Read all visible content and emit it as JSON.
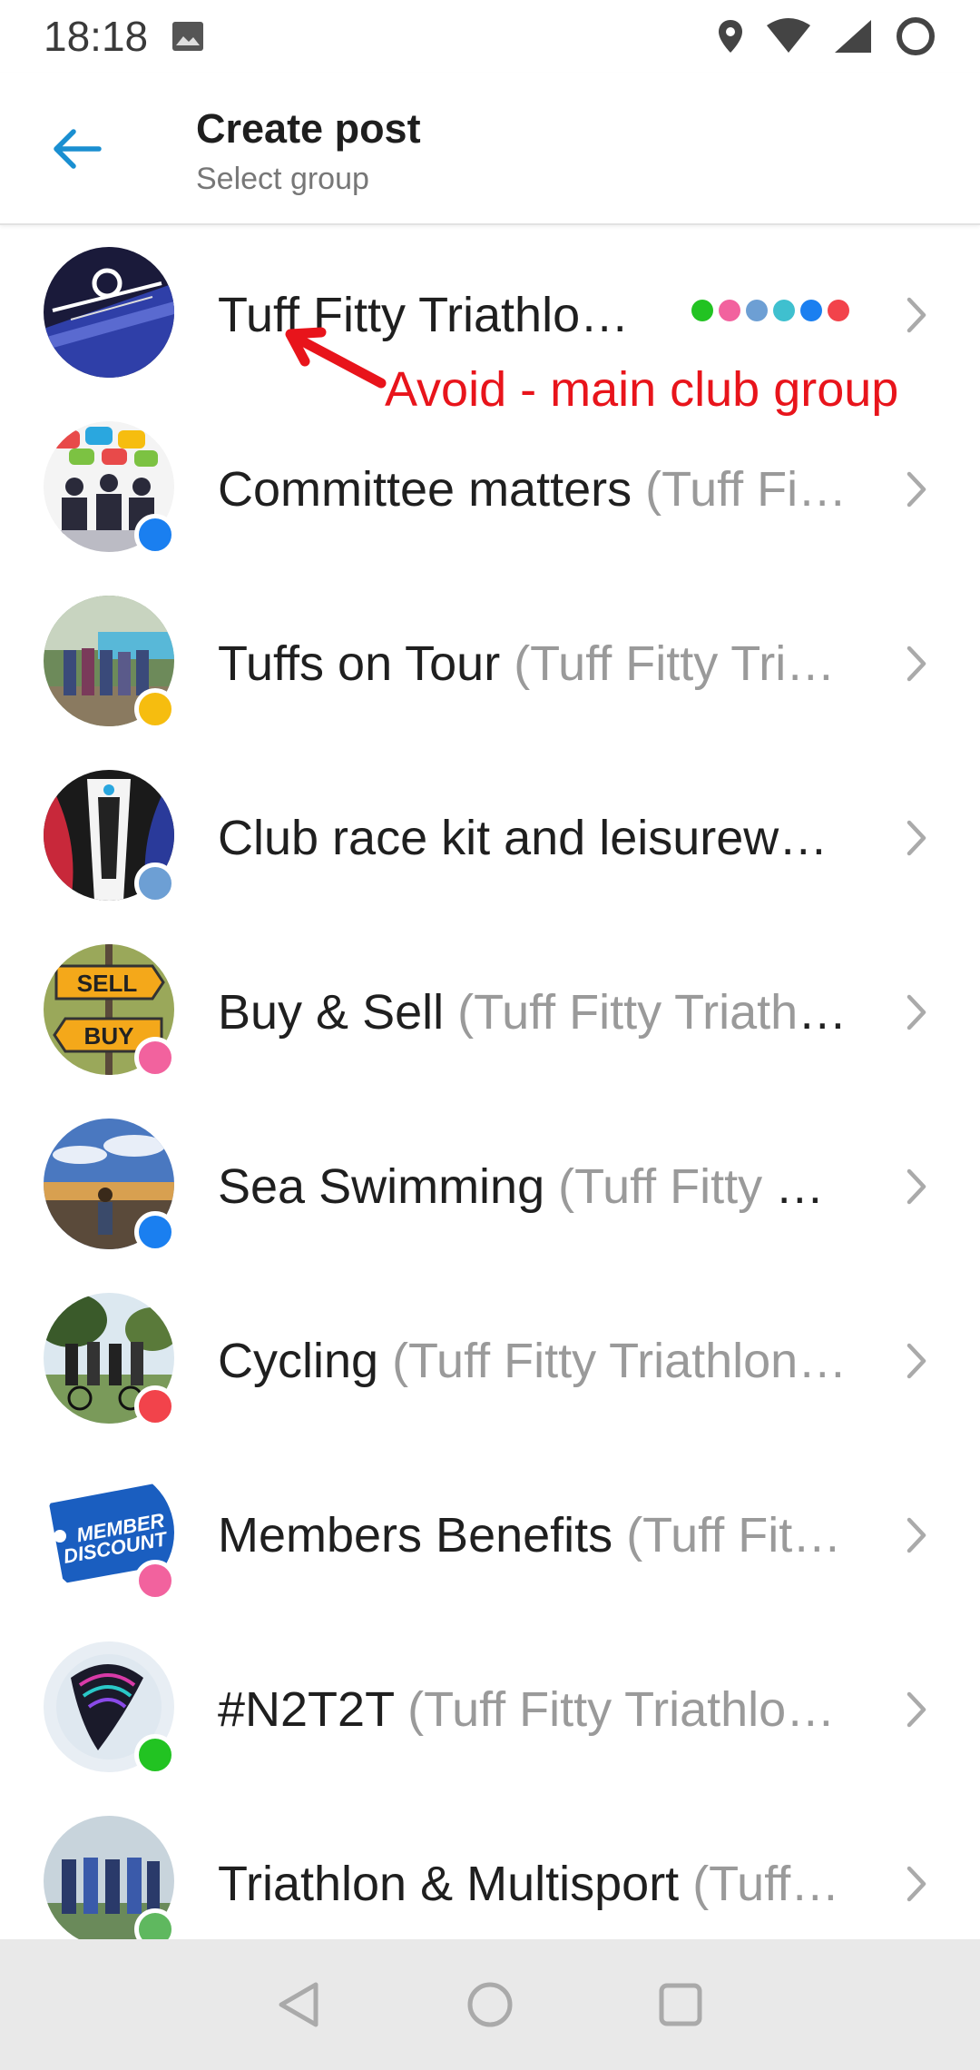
{
  "status_bar": {
    "time": "18:18",
    "icons": [
      "gallery-icon",
      "location-icon",
      "wifi-icon",
      "signal-icon",
      "battery-icon"
    ]
  },
  "app_bar": {
    "title": "Create post",
    "subtitle": "Select group",
    "accent": "#1a8fd1"
  },
  "annotation": {
    "text": "Avoid - main club group",
    "color": "#e8141b"
  },
  "groups": [
    {
      "name": "Tuff Fitty Triathlo…",
      "parent": "",
      "dot_color": "",
      "indicator_colors": [
        "#22c322",
        "#f2629e",
        "#6d9fd4",
        "#3fc0cf",
        "#1a7ff0",
        "#f2434b"
      ]
    },
    {
      "name": "Committee matters",
      "parent": "(Tuff Fi…",
      "dot_color": "#1a7ff0"
    },
    {
      "name": "Tuffs on Tour",
      "parent": "(Tuff Fitty Tri…",
      "dot_color": "#f6bd0f"
    },
    {
      "name": "Club race kit and leisurewe…",
      "parent": "",
      "dot_color": "#6d9fd4"
    },
    {
      "name": "Buy & Sell",
      "parent": "(Tuff Fitty Triathl…",
      "dot_color": "#f2629e"
    },
    {
      "name": "Sea Swimming",
      "parent": "(Tuff Fitty T…",
      "dot_color": "#1a7ff0"
    },
    {
      "name": "Cycling",
      "parent": "(Tuff Fitty Triathlon…",
      "dot_color": "#f2434b"
    },
    {
      "name": "Members Benefits",
      "parent": "(Tuff Fit…",
      "dot_color": "#f2629e"
    },
    {
      "name": "#N2T2T",
      "parent": "(Tuff Fitty Triathlo…",
      "dot_color": "#22c322"
    },
    {
      "name": "Triathlon & Multisport",
      "parent": "(Tuff…",
      "dot_color": "#5fb85f"
    }
  ],
  "avatar_text": {
    "buy_sell": [
      "SELL",
      "BUY"
    ],
    "members": [
      "MEMBER",
      "DISCOUNT"
    ]
  },
  "nav_bar": {
    "buttons": [
      "back-triangle-icon",
      "home-circle-icon",
      "recents-square-icon"
    ]
  }
}
